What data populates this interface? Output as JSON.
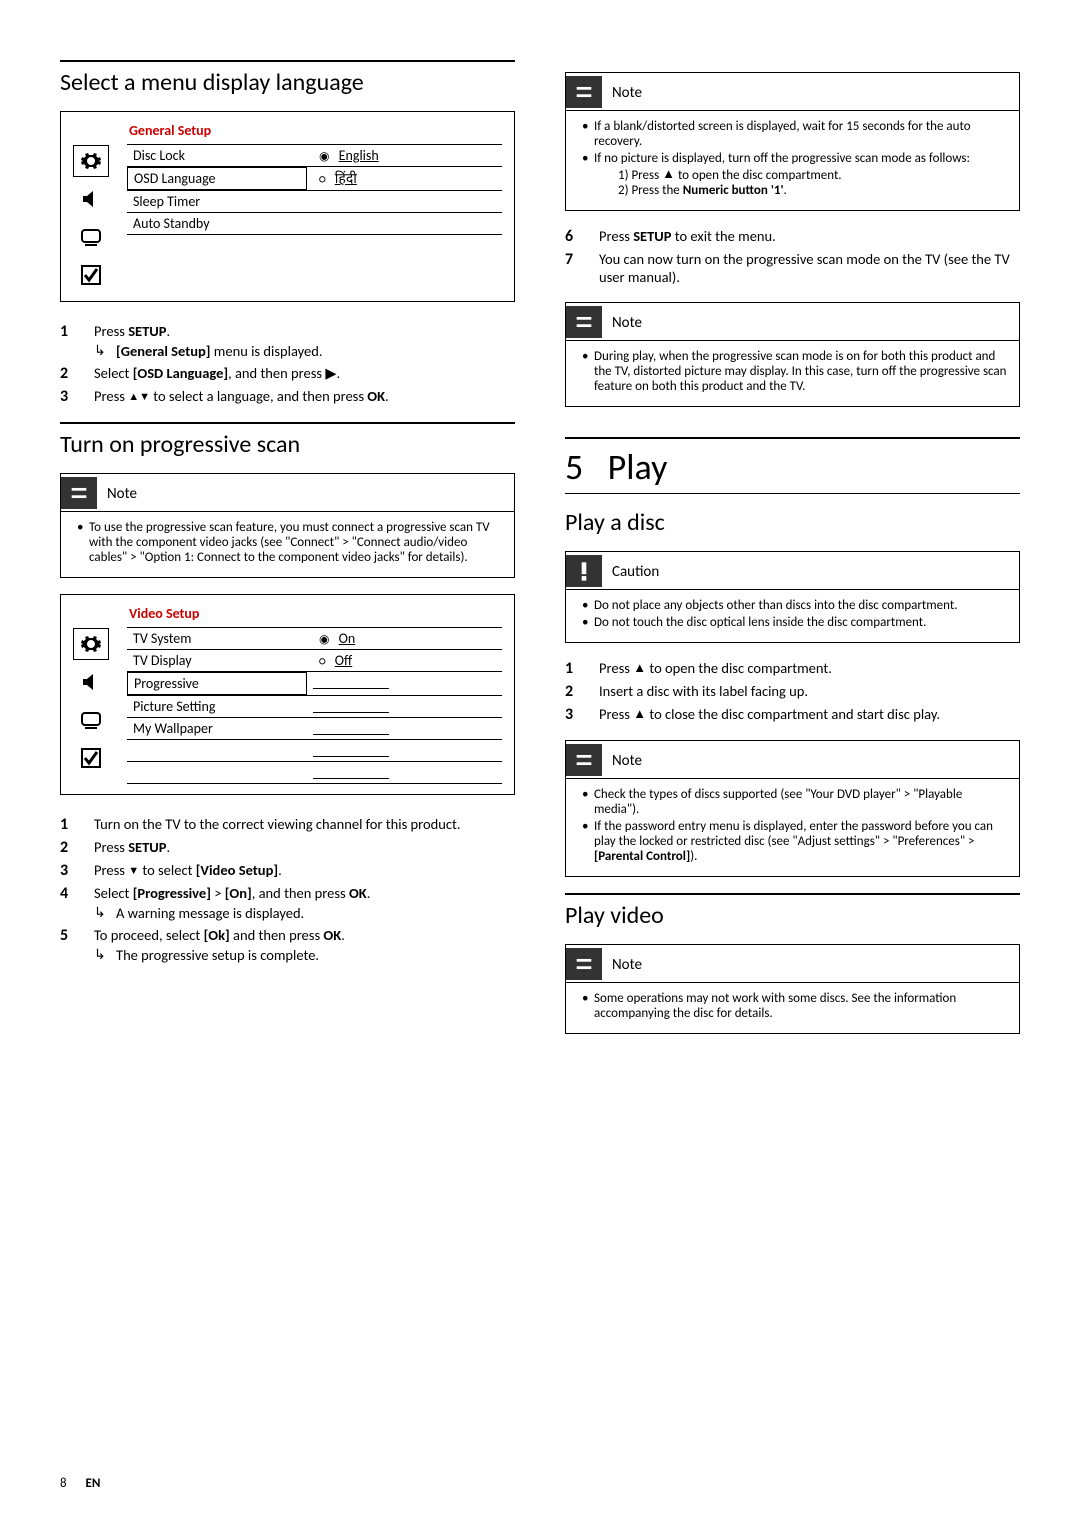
{
  "left": {
    "section1_title": "Select a menu display language",
    "panel1": {
      "title": "General Setup",
      "rows": [
        {
          "left": "Disc Lock",
          "right": "English",
          "marker": "◉"
        },
        {
          "left": "OSD Language",
          "right": "हिंदी",
          "marker": "○",
          "highlight": true
        },
        {
          "left": "Sleep Timer",
          "right": ""
        },
        {
          "left": "Auto Standby",
          "right": ""
        }
      ]
    },
    "steps1": [
      {
        "n": "1",
        "pre": "Press ",
        "bold": "SETUP",
        "post": ".",
        "result_pre": "",
        "result_bold": "[General Setup]",
        "result_post": " menu is displayed."
      },
      {
        "n": "2",
        "pre": "Select ",
        "bold": "[OSD Language]",
        "post": ", and then press ▶."
      },
      {
        "n": "3",
        "pre": "Press ",
        "icons": "▲▼",
        "post2": " to select a language, and then press ",
        "bold2": "OK",
        "post3": "."
      }
    ],
    "section2_title": "Turn on progressive scan",
    "note1_title": "Note",
    "note1_body": "To use the progressive scan feature, you must connect a progressive scan TV with the component video jacks (see \"Connect\" > \"Connect audio/video cables\" > \"Option 1: Connect to the component video jacks\" for details).",
    "panel2": {
      "title": "Video Setup",
      "rows": [
        {
          "left": "TV System",
          "right": "On",
          "marker": "◉"
        },
        {
          "left": "TV Display",
          "right": "Off",
          "marker": "○"
        },
        {
          "left": "Progressive",
          "right": "",
          "highlight": true
        },
        {
          "left": "Picture Setting",
          "right": ""
        },
        {
          "left": "My Wallpaper",
          "right": ""
        }
      ],
      "extra_lines": 3
    },
    "steps2": [
      {
        "n": "1",
        "text": "Turn on the TV to the correct viewing channel for this product."
      },
      {
        "n": "2",
        "pre": "Press ",
        "bold": "SETUP",
        "post": "."
      },
      {
        "n": "3",
        "pre": "Press ",
        "icon": "▼",
        "post": " to select ",
        "bold": "[Video Setup]",
        "post2": "."
      },
      {
        "n": "4",
        "pre": "Select ",
        "bold": "[Progressive]",
        "mid": " > ",
        "bold2": "[On]",
        "post": ", and then press ",
        "bold3": "OK",
        "post2": ".",
        "result": "A warning message is displayed."
      },
      {
        "n": "5",
        "pre": "To proceed, select ",
        "bold": "[Ok]",
        "post": " and then press ",
        "bold2": "OK",
        "post2": ".",
        "result": "The progressive setup is complete."
      }
    ]
  },
  "right": {
    "noteA_title": "Note",
    "noteA": {
      "items": [
        "If a blank/distorted screen is displayed, wait for 15 seconds for the auto recovery.",
        "If no picture is displayed, turn off the progressive scan mode as follows:"
      ],
      "sub1_pre": "1) Press ",
      "sub1_icon": "▲",
      "sub1_post": " to open the disc compartment.",
      "sub2_pre": "2) Press the ",
      "sub2_bold": "Numeric button '1'",
      "sub2_post": "."
    },
    "steps3": [
      {
        "n": "6",
        "pre": "Press ",
        "bold": "SETUP",
        "post": " to exit the menu."
      },
      {
        "n": "7",
        "text": "You can now turn on the progressive scan mode on the TV (see the TV user manual)."
      }
    ],
    "noteB_title": "Note",
    "noteB_body": "During play, when the progressive scan mode is on for both this product and the TV, distorted picture may display. In this case, turn off the progressive scan feature on both this product and the TV.",
    "chapter_num": "5",
    "chapter_title": "Play",
    "section3_title": "Play a disc",
    "caution_title": "Caution",
    "caution_items": [
      "Do not place any objects other than discs into the disc compartment.",
      "Do not touch the disc optical lens inside the disc compartment."
    ],
    "steps4": [
      {
        "n": "1",
        "pre": "Press ",
        "icon": "▲",
        "post": " to open the disc compartment."
      },
      {
        "n": "2",
        "text": "Insert a disc with its label facing up."
      },
      {
        "n": "3",
        "pre": "Press ",
        "icon": "▲",
        "post": " to close the disc compartment and start disc play."
      }
    ],
    "noteC_title": "Note",
    "noteC": {
      "item1": "Check the types of discs supported (see \"Your DVD player\" > \"Playable media\").",
      "item2_pre": "If the password entry menu is displayed, enter the password before you can play the locked or restricted disc (see \"Adjust settings\" > \"Preferences\" > ",
      "item2_bold": "[Parental Control]",
      "item2_post": ")."
    },
    "section4_title": "Play video",
    "noteD_title": "Note",
    "noteD_body": "Some operations may not work with some discs. See the information accompanying the disc for details."
  },
  "footer": {
    "page": "8",
    "lang": "EN"
  }
}
